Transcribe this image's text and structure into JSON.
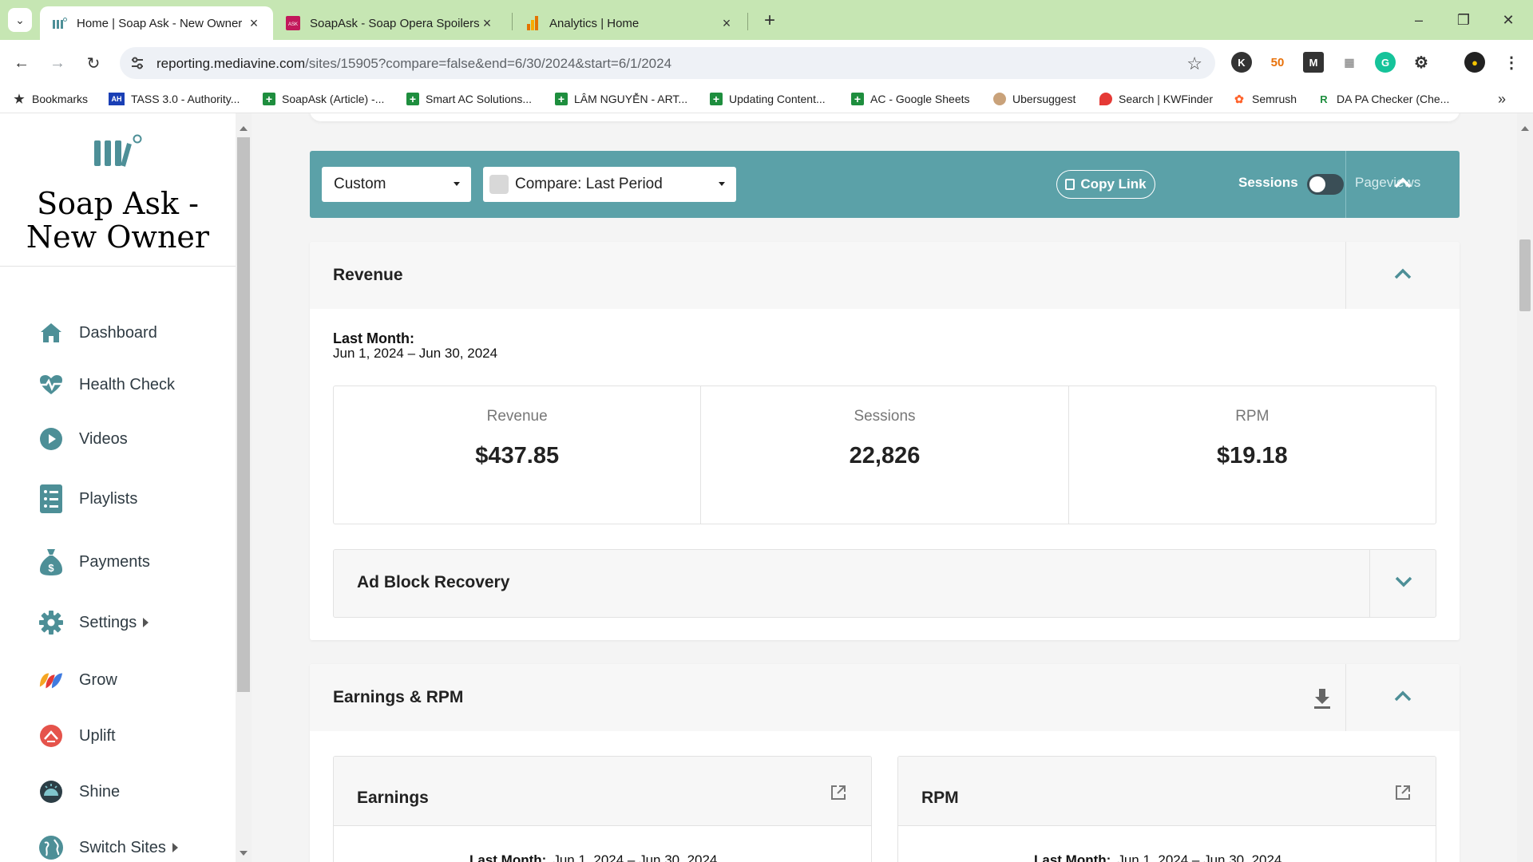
{
  "browser": {
    "tabs": [
      {
        "title": "Home | Soap Ask - New Owner",
        "active": true
      },
      {
        "title": "SoapAsk - Soap Opera Spoilers",
        "active": false
      },
      {
        "title": "Analytics | Home",
        "active": false
      }
    ],
    "url_host": "reporting.mediavine.com",
    "url_path": "/sites/15905?compare=false&end=6/30/2024&start=6/1/2024",
    "bookmarks": [
      "Bookmarks",
      "TASS 3.0 - Authority...",
      "SoapAsk (Article) -...",
      "Smart AC Solutions...",
      "LÂM NGUYỄN - ART...",
      "Updating Content...",
      "AC - Google Sheets",
      "Ubersuggest",
      "Search | KWFinder",
      "Semrush",
      "DA PA Checker (Che..."
    ],
    "colors": {
      "tabbar": "#c6e6b3",
      "accent": "#5ba1a8"
    }
  },
  "sidebar": {
    "site_name": "Soap Ask - New Owner",
    "items": [
      {
        "label": "Dashboard",
        "icon": "home-icon"
      },
      {
        "label": "Health Check",
        "icon": "heartbeat-icon"
      },
      {
        "label": "Videos",
        "icon": "play-icon"
      },
      {
        "label": "Playlists",
        "icon": "list-icon"
      },
      {
        "label": "Payments",
        "icon": "money-bag-icon"
      },
      {
        "label": "Settings",
        "icon": "gear-icon"
      },
      {
        "label": "Grow",
        "icon": "grow-icon"
      },
      {
        "label": "Uplift",
        "icon": "uplift-icon"
      },
      {
        "label": "Shine",
        "icon": "shine-icon"
      },
      {
        "label": "Switch Sites",
        "icon": "globe-icon"
      }
    ]
  },
  "filters": {
    "range_select": "Custom",
    "compare_select": "Compare: Last Period",
    "copy_link": "Copy Link",
    "toggle_left": "Sessions",
    "toggle_right": "Pageviews"
  },
  "revenue": {
    "title": "Revenue",
    "period_label": "Last Month:",
    "period_range": "Jun 1, 2024 – Jun 30, 2024",
    "stats": [
      {
        "label": "Revenue",
        "value": "$437.85"
      },
      {
        "label": "Sessions",
        "value": "22,826"
      },
      {
        "label": "RPM",
        "value": "$19.18"
      }
    ],
    "ad_block_title": "Ad Block Recovery"
  },
  "earnings": {
    "title": "Earnings & RPM",
    "cards": [
      {
        "title": "Earnings",
        "period_label": "Last Month:",
        "period_range": "Jun 1, 2024 – Jun 30, 2024"
      },
      {
        "title": "RPM",
        "period_label": "Last Month:",
        "period_range": "Jun 1, 2024 – Jun 30, 2024"
      }
    ]
  }
}
